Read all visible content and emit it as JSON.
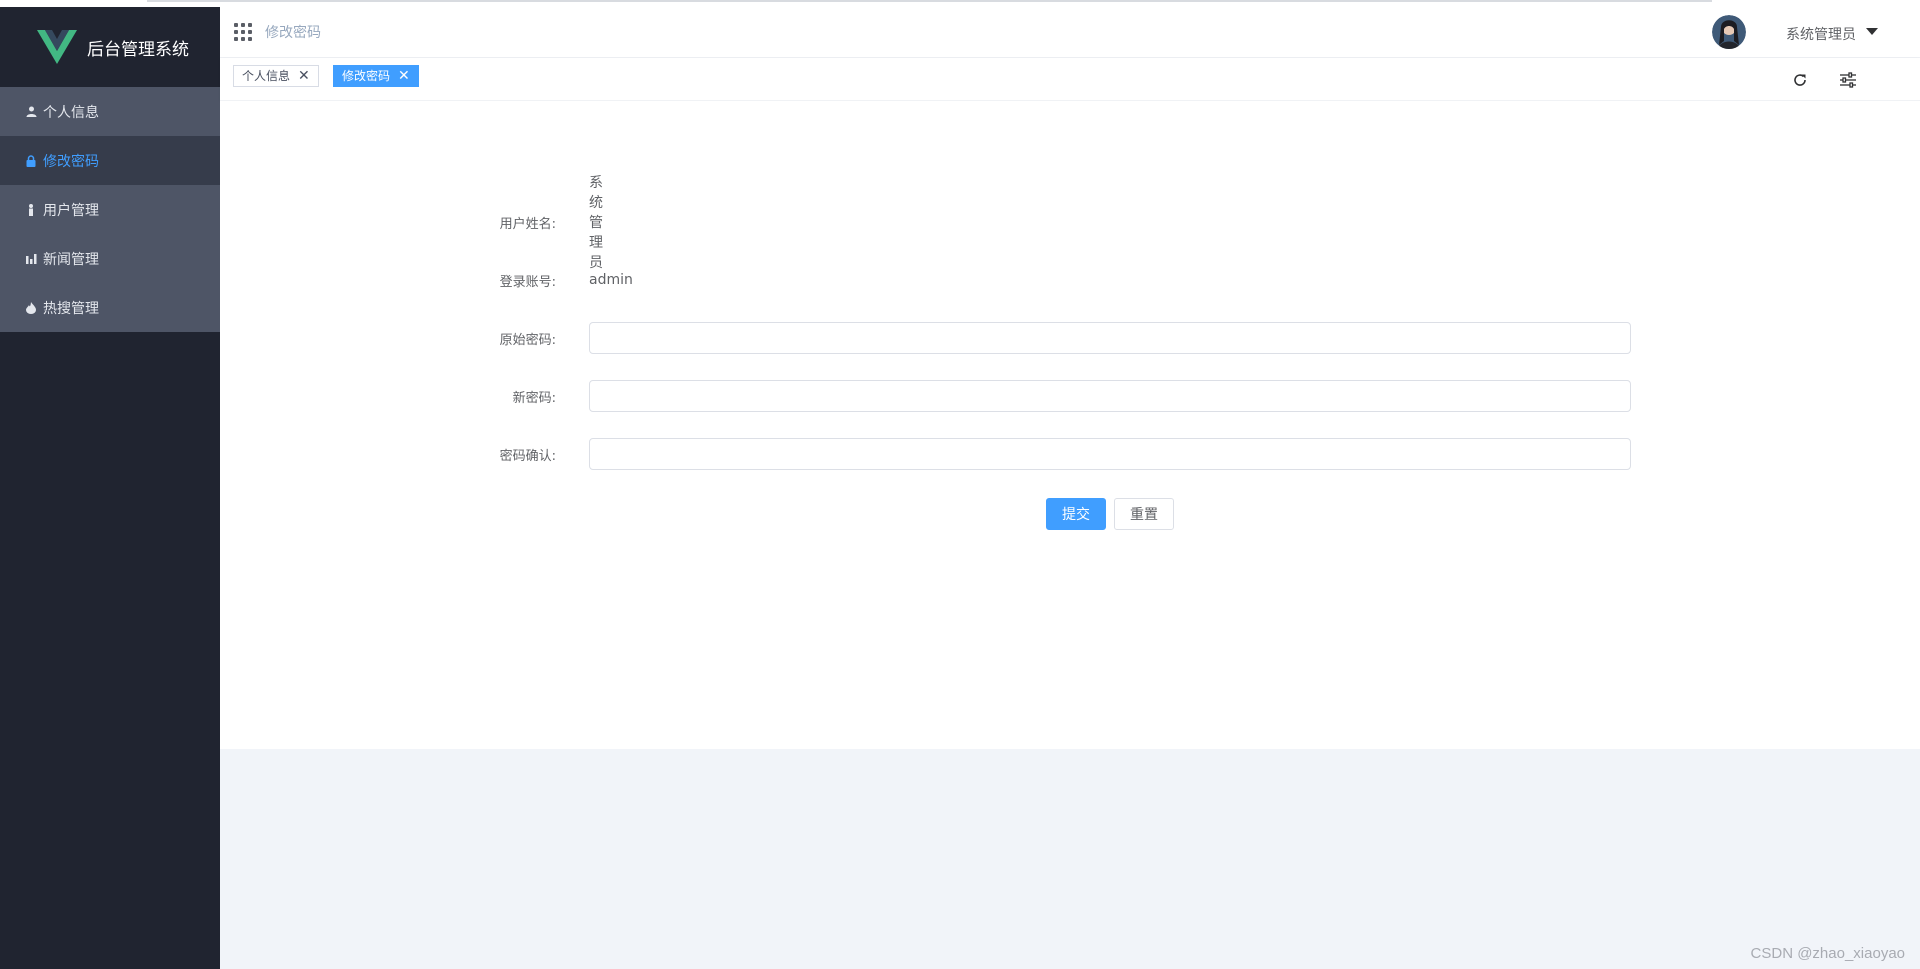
{
  "app": {
    "title": "后台管理系统"
  },
  "sidebar": {
    "items": [
      {
        "label": "个人信息",
        "icon": "user-icon",
        "active": false
      },
      {
        "label": "修改密码",
        "icon": "lock-icon",
        "active": true
      },
      {
        "label": "用户管理",
        "icon": "person-icon",
        "active": false
      },
      {
        "label": "新闻管理",
        "icon": "bar-chart-icon",
        "active": false
      },
      {
        "label": "热搜管理",
        "icon": "fire-icon",
        "active": false
      }
    ]
  },
  "header": {
    "breadcrumb": "修改密码",
    "user_name": "系统管理员"
  },
  "tags": [
    {
      "label": "个人信息",
      "close": "✕",
      "active": false
    },
    {
      "label": "修改密码",
      "close": "✕",
      "active": true
    }
  ],
  "form": {
    "username_label": "用户姓名:",
    "username_value": "系统管理员",
    "account_label": "登录账号:",
    "account_value": "admin",
    "old_password_label": "原始密码:",
    "old_password_value": "",
    "new_password_label": "新密码:",
    "new_password_value": "",
    "confirm_password_label": "密码确认:",
    "confirm_password_value": "",
    "submit_label": "提交",
    "reset_label": "重置"
  },
  "watermark": "CSDN @zhao_xiaoyao",
  "colors": {
    "sidebar_bg": "#202430",
    "menu_item_bg": "#4e5566",
    "menu_active_bg": "#363c4b",
    "accent": "#409eff",
    "logo_green": "#42b883"
  }
}
